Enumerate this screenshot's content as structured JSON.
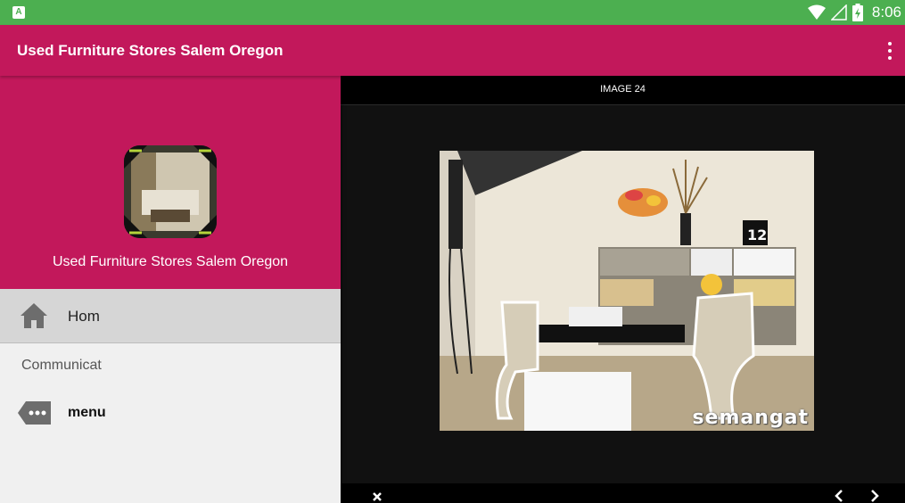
{
  "status_bar": {
    "time": "8:06",
    "app_badge": "A"
  },
  "app_bar": {
    "title": "Used Furniture Stores Salem Oregon",
    "overflow_icon": "more-vert-icon"
  },
  "drawer": {
    "header_title": "Used Furniture Stores Salem Oregon",
    "items": [
      {
        "label": "Hom",
        "icon": "home-icon"
      }
    ],
    "section_label": "Communicat",
    "section_items": [
      {
        "label": "menu",
        "icon": "more-tag-icon"
      }
    ]
  },
  "viewer": {
    "title": "IMAGE 24",
    "watermark": "semangat",
    "controls": {
      "close_icon": "close-icon",
      "prev_icon": "chevron-left-icon",
      "next_icon": "chevron-right-icon"
    }
  },
  "colors": {
    "status_bar": "#4caf50",
    "primary": "#c2185b",
    "drawer_bg": "#f0f0f0",
    "viewer_bg": "#111111"
  }
}
